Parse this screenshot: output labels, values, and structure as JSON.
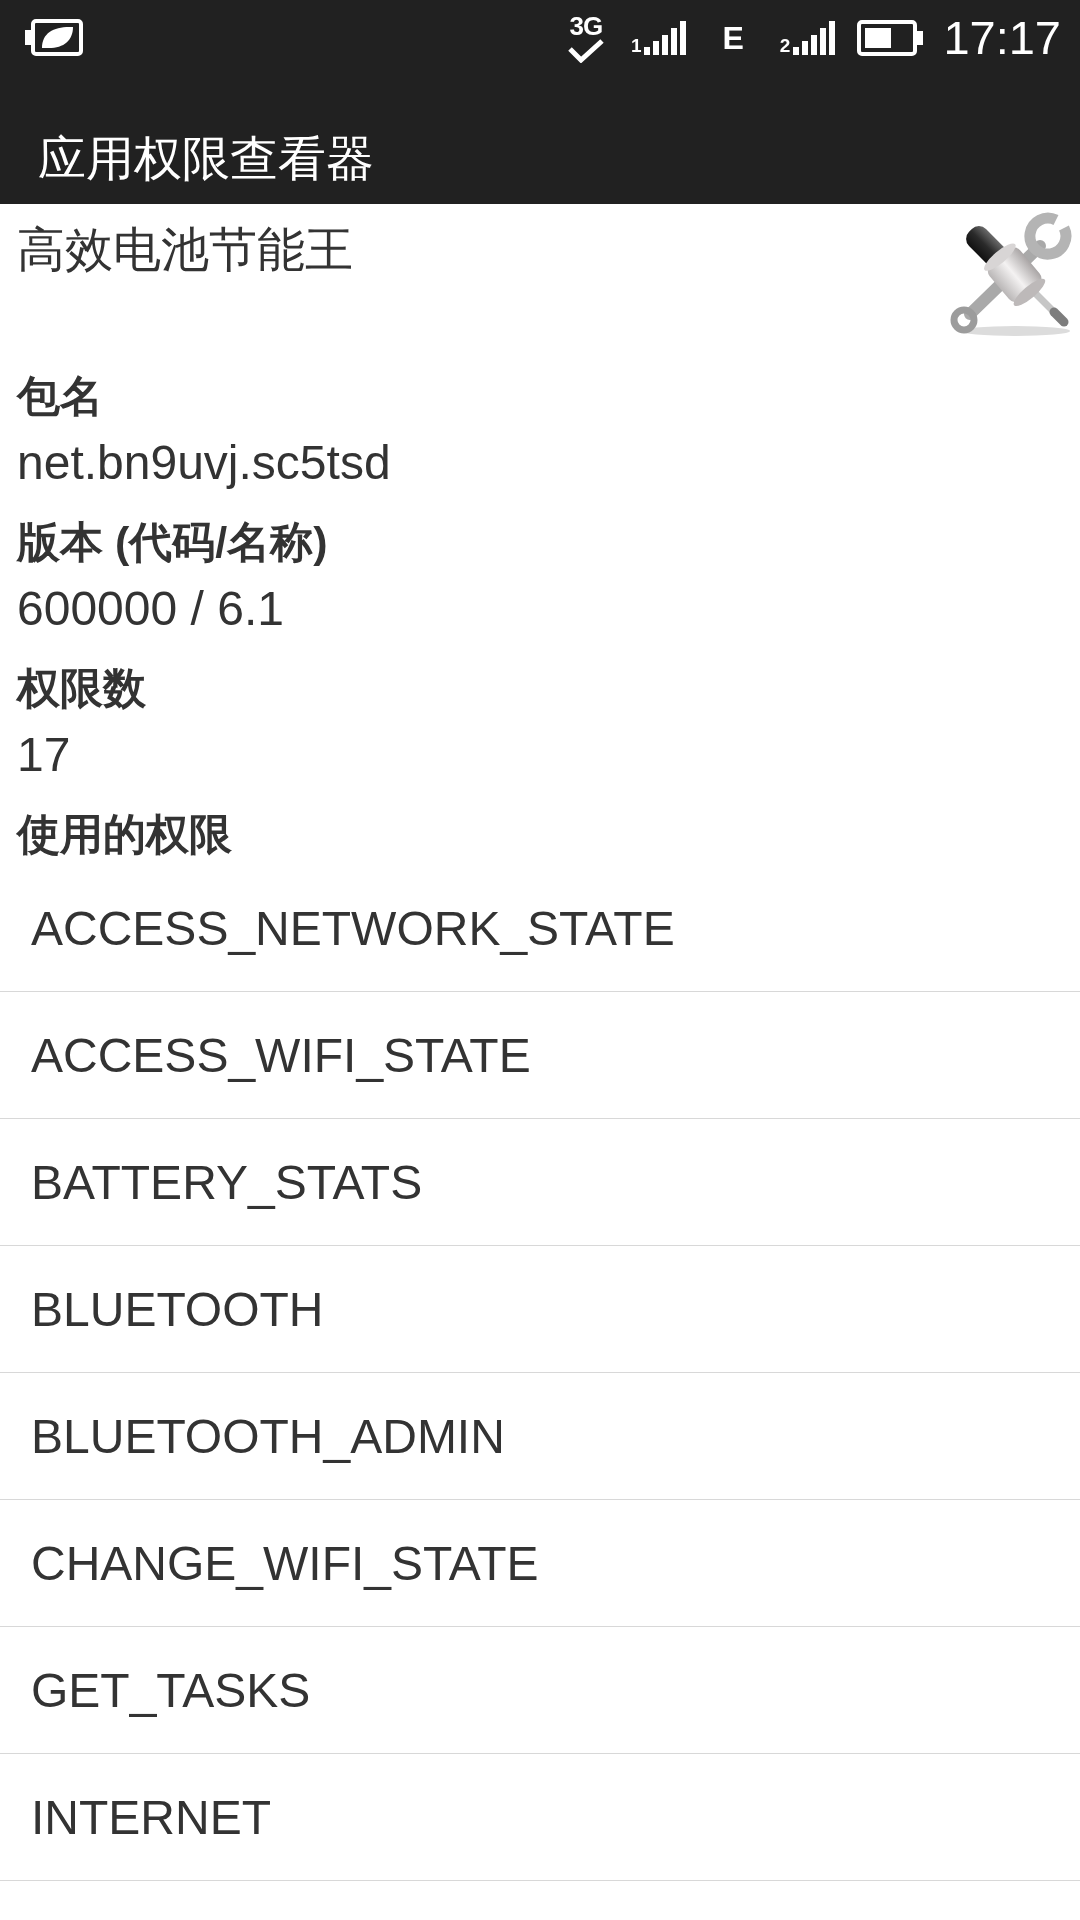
{
  "status_bar": {
    "indicators": [
      {
        "kind": "data_check",
        "text": "3G"
      },
      {
        "kind": "signal",
        "text": "1"
      },
      {
        "kind": "data",
        "text": "E"
      },
      {
        "kind": "signal",
        "text": "2"
      }
    ],
    "time": "17:17"
  },
  "action_bar": {
    "title": "应用权限查看器"
  },
  "app": {
    "name": "高效电池节能王"
  },
  "details": [
    {
      "label": "包名",
      "value": "net.bn9uvj.sc5tsd"
    },
    {
      "label": "版本 (代码/名称)",
      "value": "600000 / 6.1"
    },
    {
      "label": "权限数",
      "value": "17"
    }
  ],
  "permissions": {
    "label": "使用的权限",
    "items": [
      "ACCESS_NETWORK_STATE",
      "ACCESS_WIFI_STATE",
      "BATTERY_STATS",
      "BLUETOOTH",
      "BLUETOOTH_ADMIN",
      "CHANGE_WIFI_STATE",
      "GET_TASKS",
      "INTERNET"
    ]
  }
}
